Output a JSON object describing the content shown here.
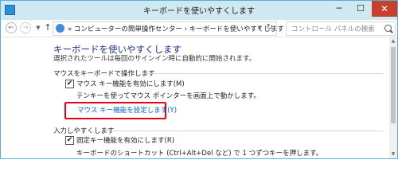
{
  "window": {
    "title": "キーボードを使いやすくします",
    "minimize_glyph": "─",
    "maximize_glyph": "☐",
    "close_glyph": "✕"
  },
  "nav": {
    "back_glyph": "←",
    "forward_glyph": "→",
    "dropdown_glyph": "▼",
    "up_glyph": "↑",
    "address": "« コンピューターの簡単操作センター › キーボードを使いやすくします",
    "address_dropdown_glyph": "▼",
    "refresh_glyph": "↻",
    "search_placeholder": "コントロール パネルの検索"
  },
  "main": {
    "title": "キーボードを使いやすくします",
    "subtitle": "選択されたツールは毎回のサインイン時に自動的に開始されます。",
    "sections": [
      {
        "header": "マウスをキーボードで操作します",
        "checkbox_label": "マウス キー機能を有効にします(M)",
        "checked": true,
        "description": "テンキーを使ってマウス ポインターを画面上で動かします。",
        "link": "マウス キー機能を設定します(Y)"
      },
      {
        "header": "入力しやすくします",
        "checkbox_label": "固定キー機能を有効にします(R)",
        "checked": true,
        "description": "キーボードのショートカット (Ctrl+Alt+Del など) で 1 つずつキーを押します。"
      }
    ],
    "checkmark_glyph": "✔"
  },
  "scrollbar": {
    "up_glyph": "▲",
    "down_glyph": "▼"
  },
  "colors": {
    "titlebar": "#cfe8f2",
    "close_button": "#c7402d",
    "title_blue": "#1e3287",
    "link_blue": "#0066cc",
    "highlight_red": "#e60012"
  }
}
